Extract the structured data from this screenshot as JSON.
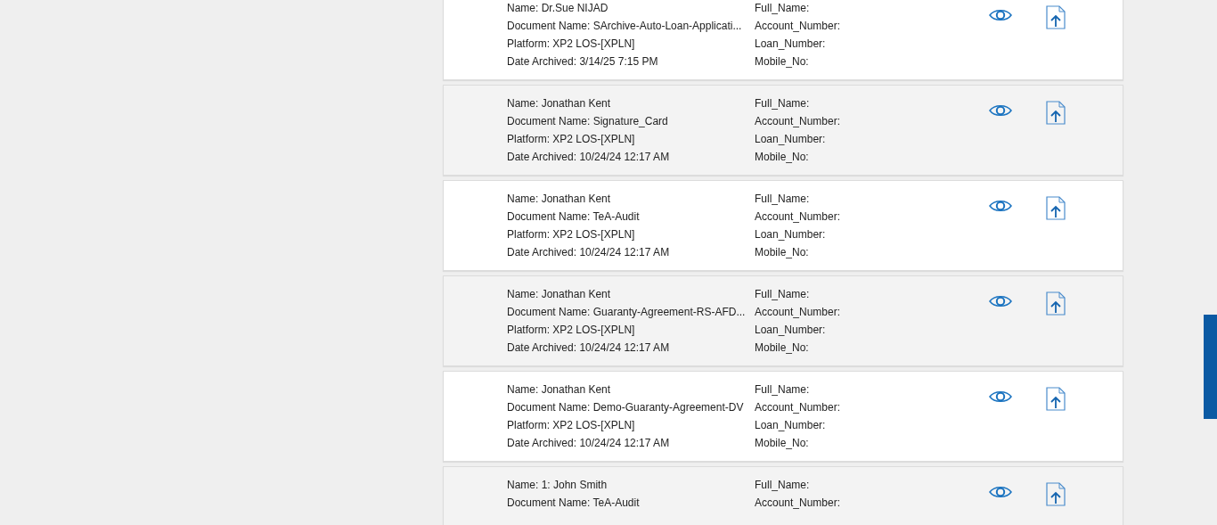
{
  "records": [
    {
      "details": [
        "Name: Dr.Sue NIJAD",
        "Document Name: SArchive-Auto-Loan-Applicati...",
        "Platform: XP2 LOS-[XPLN]",
        "Date Archived: 3/14/25 7:15 PM"
      ],
      "attributes": [
        "Full_Name:",
        "Account_Number:",
        "Loan_Number:",
        "Mobile_No:"
      ]
    },
    {
      "details": [
        "Name: Jonathan Kent",
        "Document Name: Signature_Card",
        "Platform: XP2 LOS-[XPLN]",
        "Date Archived: 10/24/24 12:17 AM"
      ],
      "attributes": [
        "Full_Name:",
        "Account_Number:",
        "Loan_Number:",
        "Mobile_No:"
      ]
    },
    {
      "details": [
        "Name: Jonathan Kent",
        "Document Name: TeA-Audit",
        "Platform: XP2 LOS-[XPLN]",
        "Date Archived: 10/24/24 12:17 AM"
      ],
      "attributes": [
        "Full_Name:",
        "Account_Number:",
        "Loan_Number:",
        "Mobile_No:"
      ]
    },
    {
      "details": [
        "Name: Jonathan Kent",
        "Document Name: Guaranty-Agreement-RS-AFD...",
        "Platform: XP2 LOS-[XPLN]",
        "Date Archived: 10/24/24 12:17 AM"
      ],
      "attributes": [
        "Full_Name:",
        "Account_Number:",
        "Loan_Number:",
        "Mobile_No:"
      ]
    },
    {
      "details": [
        "Name: Jonathan Kent",
        "Document Name: Demo-Guaranty-Agreement-DV",
        "Platform: XP2 LOS-[XPLN]",
        "Date Archived: 10/24/24 12:17 AM"
      ],
      "attributes": [
        "Full_Name:",
        "Account_Number:",
        "Loan_Number:",
        "Mobile_No:"
      ]
    },
    {
      "details": [
        "Name: 1: John Smith",
        "Document Name: TeA-Audit"
      ],
      "attributes": [
        "Full_Name:",
        "Account_Number:"
      ]
    }
  ]
}
